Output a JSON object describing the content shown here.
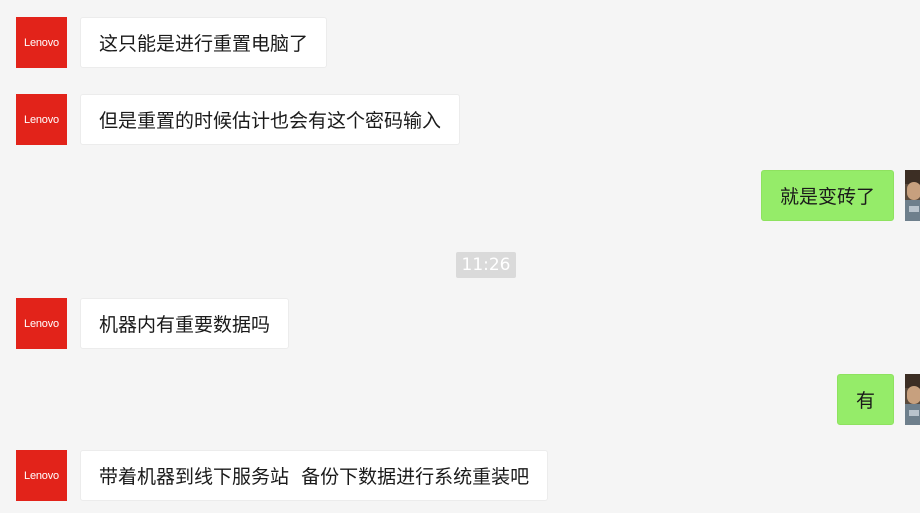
{
  "contact": {
    "avatar_text": "Lenovo"
  },
  "messages": [
    {
      "from": "contact",
      "text": "这只能是进行重置电脑了"
    },
    {
      "from": "contact",
      "text": "但是重置的时候估计也会有这个密码输入"
    },
    {
      "from": "me",
      "text": "就是变砖了"
    },
    {
      "from": "contact",
      "text": "机器内有重要数据吗"
    },
    {
      "from": "me",
      "text": "有"
    },
    {
      "from": "contact",
      "text": "带着机器到线下服务站  备份下数据进行系统重装吧"
    }
  ],
  "timestamp": "11:26",
  "colors": {
    "background": "#f5f5f5",
    "incoming_bubble": "#ffffff",
    "outgoing_bubble": "#95ec69",
    "lenovo_red": "#e2231a",
    "timestamp_bg": "#dadada"
  }
}
